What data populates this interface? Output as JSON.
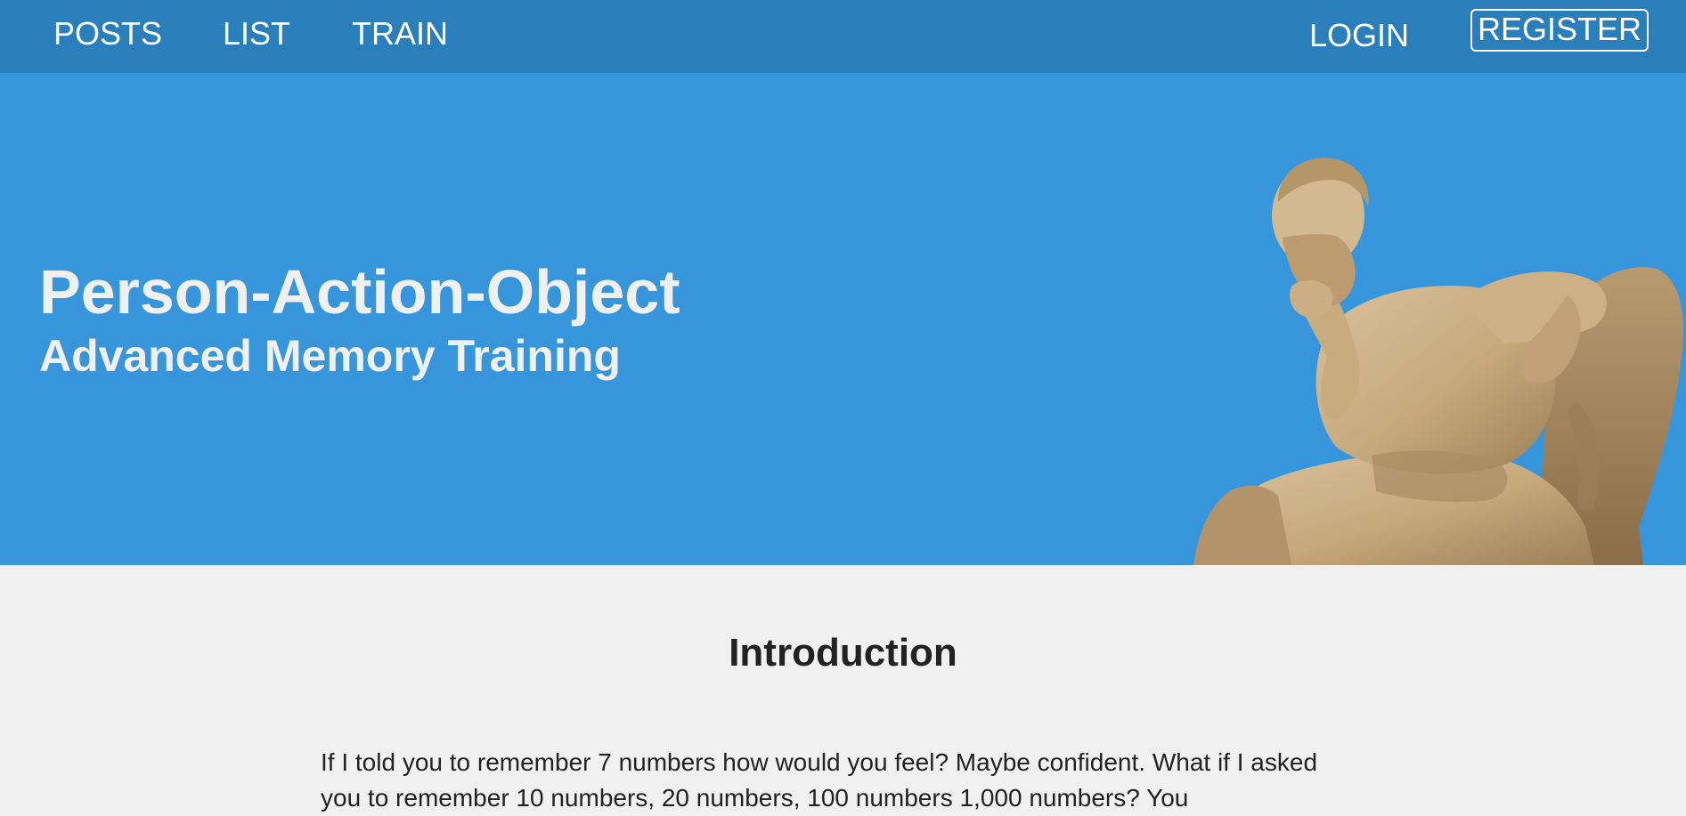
{
  "nav": {
    "posts": "POSTS",
    "list": "LIST",
    "train": "TRAIN",
    "login": "LOGIN",
    "register": "REGISTER"
  },
  "hero": {
    "title": "Person-Action-Object",
    "subtitle": "Advanced Memory Training",
    "image": "thinker-statue"
  },
  "intro": {
    "heading": "Introduction",
    "paragraph": "If I told you to remember 7 numbers how would you feel? Maybe confident. What if I asked you to remember 10 numbers, 20 numbers, 100 numbers 1,000 numbers? You"
  },
  "colors": {
    "navbar": "#2a7fbb",
    "hero": "#3796db",
    "page_background": "#f0f0f0",
    "text": "#222222"
  }
}
